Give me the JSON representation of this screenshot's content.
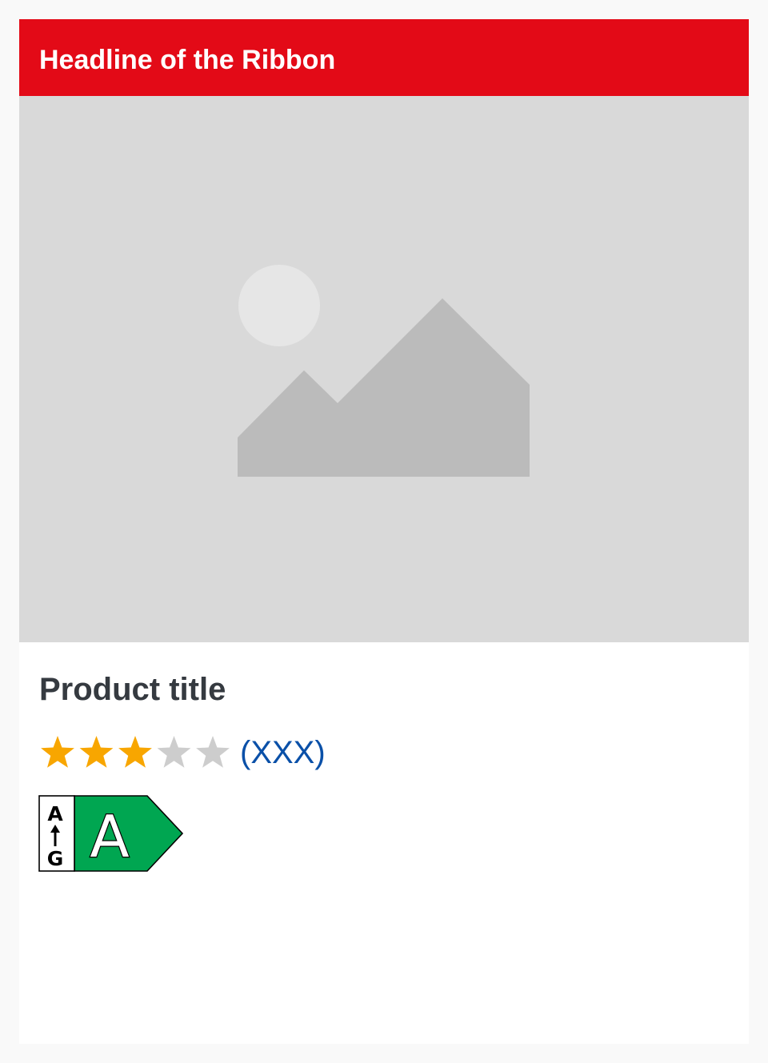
{
  "ribbon": {
    "headline": "Headline of the Ribbon",
    "background_color": "#e30a17"
  },
  "image": {
    "placeholder_icon": "image-placeholder-icon"
  },
  "product": {
    "title": "Product title"
  },
  "rating": {
    "stars_filled": 3,
    "stars_total": 5,
    "review_count": "(XXX)",
    "filled_color": "#f8a600",
    "empty_color": "#cdcdcd"
  },
  "energy_label": {
    "scale_top": "A",
    "scale_bottom": "G",
    "class": "A",
    "color": "#00a651"
  }
}
